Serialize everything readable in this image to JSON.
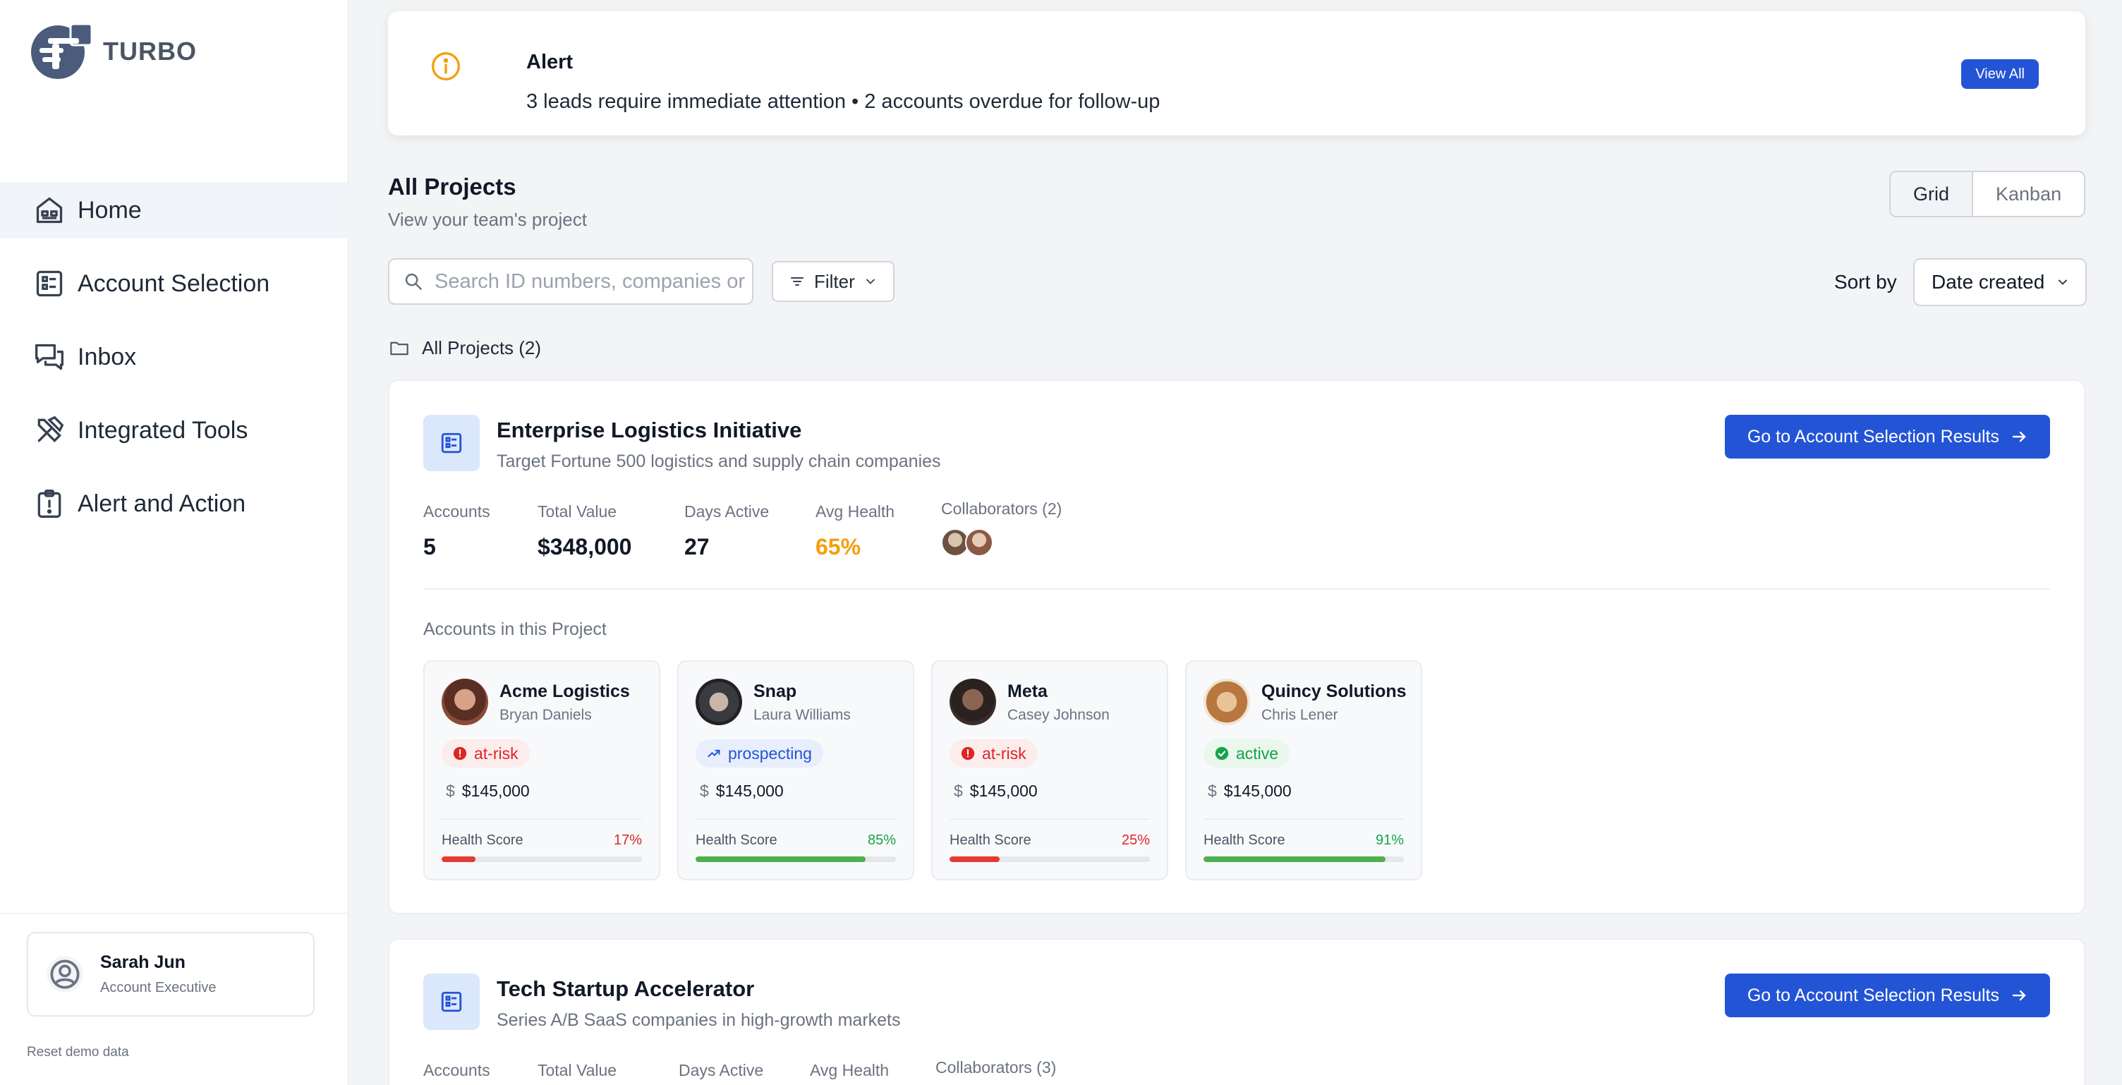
{
  "app": {
    "logo_text": "TURBO"
  },
  "sidebar": {
    "items": [
      {
        "label": "Home",
        "icon": "home-icon"
      },
      {
        "label": "Account Selection",
        "icon": "list-icon"
      },
      {
        "label": "Inbox",
        "icon": "chat-icon"
      },
      {
        "label": "Integrated Tools",
        "icon": "tools-icon"
      },
      {
        "label": "Alert and Action",
        "icon": "alert-clipboard-icon"
      }
    ],
    "active_index": 0,
    "user": {
      "name": "Sarah Jun",
      "role": "Account Executive"
    },
    "reset_label": "Reset demo data"
  },
  "alert": {
    "title": "Alert",
    "message": "3 leads require immediate attention • 2 accounts overdue for follow-up",
    "view_all": "View All"
  },
  "projects_header": {
    "title": "All Projects",
    "subtitle": "View your team's project",
    "views": [
      "Grid",
      "Kanban"
    ],
    "active_view": "Grid"
  },
  "toolbar": {
    "search_placeholder": "Search ID numbers, companies or contacts",
    "filter_label": "Filter",
    "sort_label": "Sort by",
    "sort_value": "Date created"
  },
  "folder": {
    "label": "All Projects (2)"
  },
  "colors": {
    "accent": "#2454d6",
    "risk": "#dc2626",
    "active": "#16a34a",
    "warn": "#f59e0b"
  },
  "projects": [
    {
      "title": "Enterprise Logistics Initiative",
      "description": "Target Fortune 500 logistics and supply chain companies",
      "cta": "Go to Account Selection Results",
      "stats": {
        "accounts_label": "Accounts",
        "accounts": "5",
        "value_label": "Total Value",
        "value": "$348,000",
        "days_label": "Days Active",
        "days": "27",
        "health_label": "Avg Health",
        "health": "65%",
        "collab_label": "Collaborators (2)"
      },
      "accounts_label": "Accounts in this Project",
      "accounts": [
        {
          "name": "Acme Logistics",
          "contact": "Bryan Daniels",
          "status": "at-risk",
          "currency": "$",
          "value": "$145,000",
          "health_label": "Health Score",
          "health": "17%",
          "health_value": 17
        },
        {
          "name": "Snap",
          "contact": "Laura Williams",
          "status": "prospecting",
          "currency": "$",
          "value": "$145,000",
          "health_label": "Health Score",
          "health": "85%",
          "health_value": 85
        },
        {
          "name": "Meta",
          "contact": "Casey Johnson",
          "status": "at-risk",
          "currency": "$",
          "value": "$145,000",
          "health_label": "Health Score",
          "health": "25%",
          "health_value": 25
        },
        {
          "name": "Quincy Solutions",
          "contact": "Chris Lener",
          "status": "active",
          "currency": "$",
          "value": "$145,000",
          "health_label": "Health Score",
          "health": "91%",
          "health_value": 91
        }
      ]
    },
    {
      "title": "Tech Startup Accelerator",
      "description": "Series A/B SaaS companies in high-growth markets",
      "cta": "Go to Account Selection Results",
      "stats": {
        "accounts_label": "Accounts",
        "value_label": "Total Value",
        "days_label": "Days Active",
        "health_label": "Avg Health",
        "collab_label": "Collaborators (3)"
      }
    }
  ]
}
